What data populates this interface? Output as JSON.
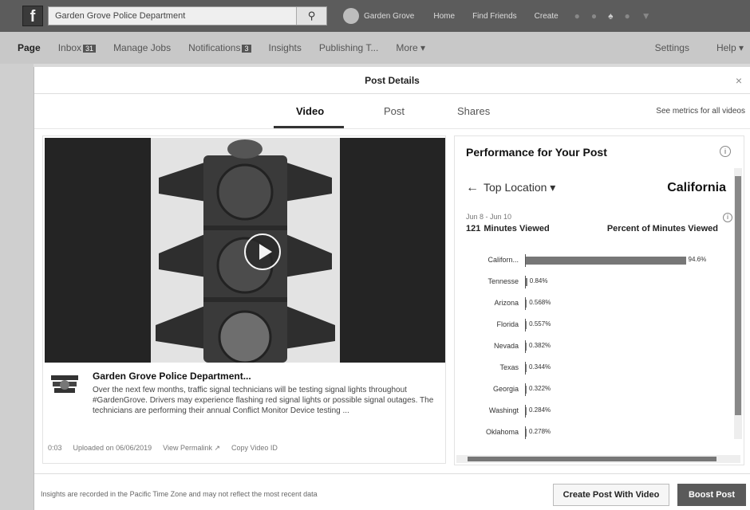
{
  "topbar": {
    "search_value": "Garden Grove Police Department",
    "search_icon": "search-icon",
    "profile_name": "Garden Grove",
    "nav": [
      "Home",
      "Find Friends",
      "Create"
    ]
  },
  "pagebar": {
    "items": [
      "Page",
      "Inbox",
      "Manage Jobs",
      "Notifications",
      "Insights",
      "Publishing T...",
      "More ▾"
    ],
    "inbox_badge": "31",
    "notifications_badge": "3",
    "right": [
      "Settings",
      "Help ▾"
    ]
  },
  "modal": {
    "title": "Post Details",
    "close": "×",
    "tabs": [
      "Video",
      "Post",
      "Shares"
    ],
    "see_metrics": "See metrics for all videos"
  },
  "post": {
    "title": "Garden Grove Police Department...",
    "body": "Over the next few months, traffic signal technicians will be testing signal lights throughout #GardenGrove. Drivers may experience flashing red signal lights or possible signal outages. The technicians are performing their annual Conflict Monitor Device testing ...",
    "duration": "0:03",
    "uploaded": "Uploaded on 06/06/2019",
    "permalink": "View Permalink ↗",
    "copy_id": "Copy Video ID"
  },
  "performance": {
    "title": "Performance for Your Post",
    "location_label": "Top Location ▾",
    "location_value": "California",
    "dates": "Jun 8 - Jun 10",
    "minutes_count": "121",
    "minutes_label": "Minutes Viewed",
    "percent_label": "Percent of Minutes Viewed"
  },
  "chart_data": {
    "type": "bar",
    "categories": [
      "Californ...",
      "Tennesse",
      "Arizona",
      "Florida",
      "Nevada",
      "Texas",
      "Georgia",
      "Washingt",
      "Oklahoma"
    ],
    "values": [
      94.6,
      0.84,
      0.568,
      0.557,
      0.382,
      0.344,
      0.322,
      0.284,
      0.278
    ],
    "value_labels": [
      "94.6%",
      "0.84%",
      "0.568%",
      "0.557%",
      "0.382%",
      "0.344%",
      "0.322%",
      "0.284%",
      "0.278%"
    ],
    "xlim": [
      0,
      100
    ]
  },
  "footer": {
    "note": "Insights are recorded in the Pacific Time Zone and may not reflect the most recent data",
    "create_button": "Create Post With Video",
    "boost_button": "Boost Post"
  }
}
